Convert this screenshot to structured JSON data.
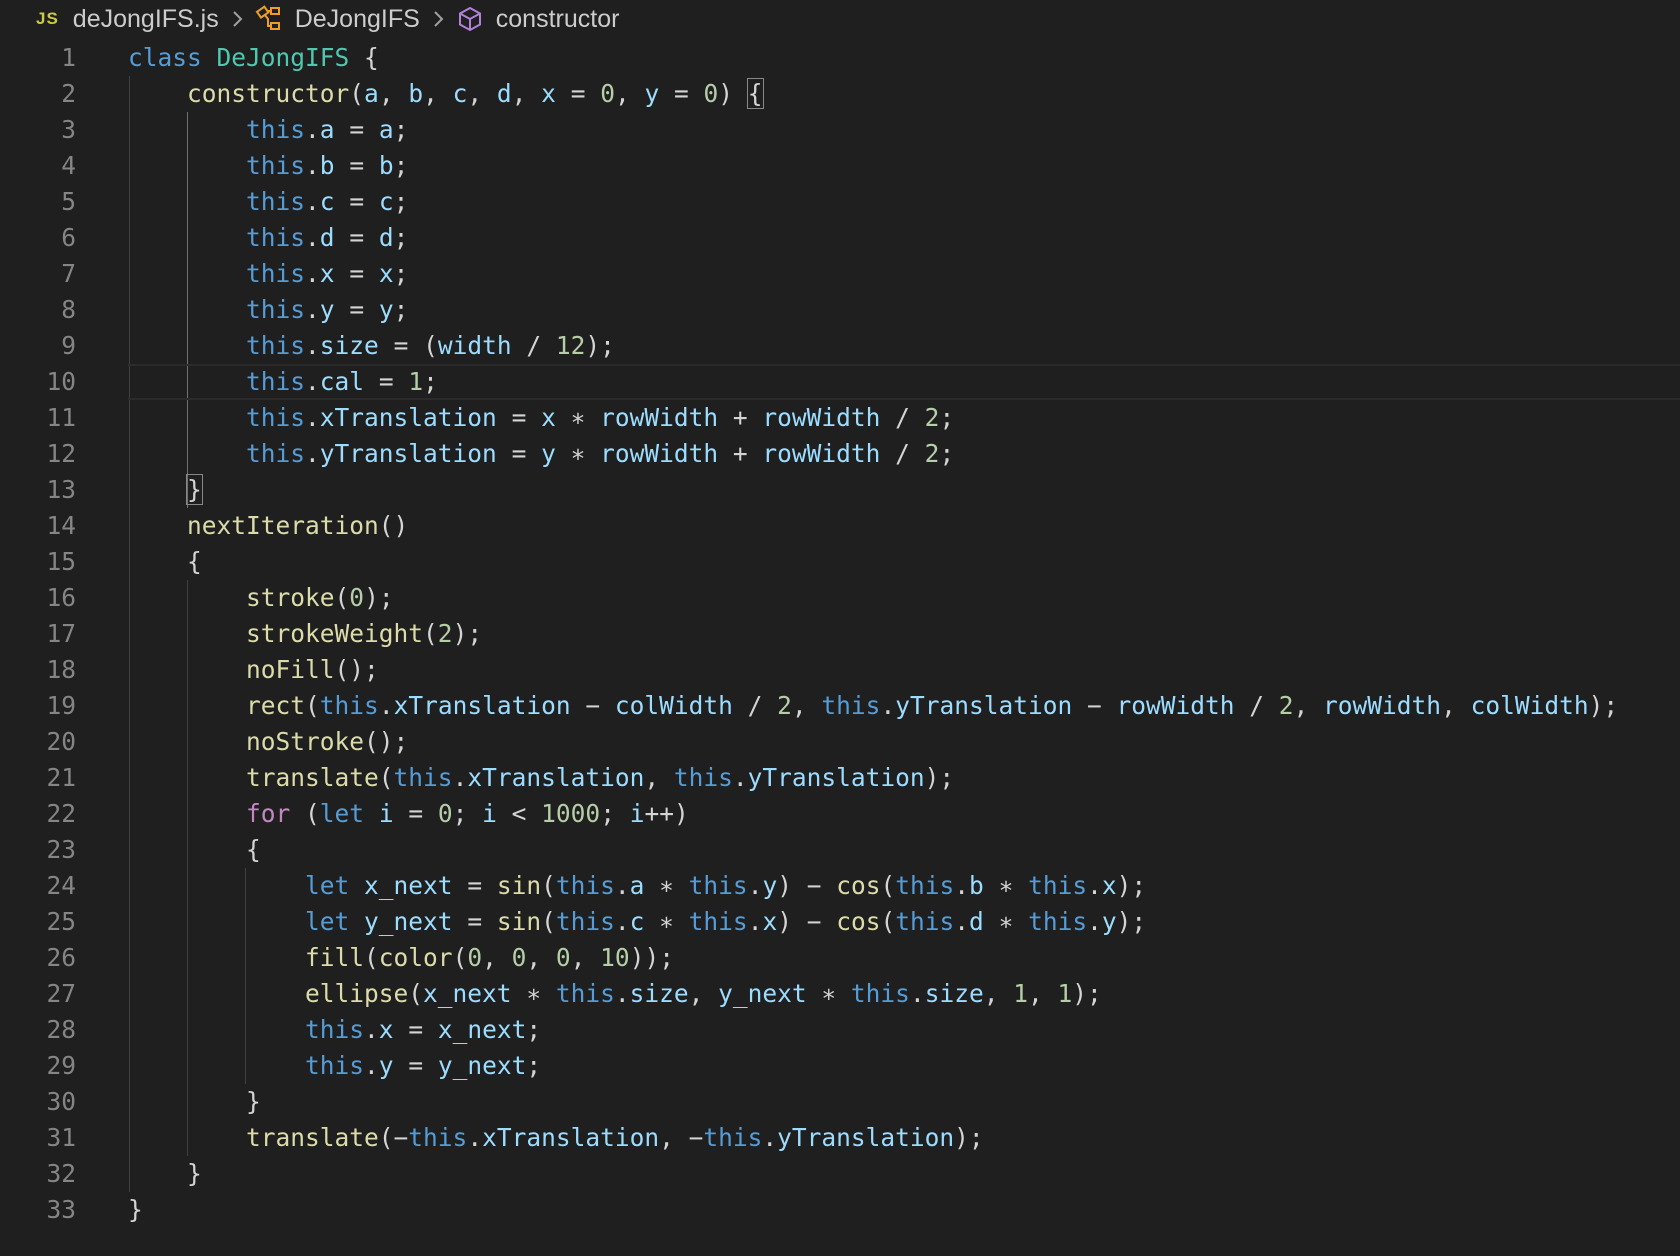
{
  "breadcrumb": {
    "file_badge": "JS",
    "file_name": "deJongIFS.js",
    "class_name": "DeJongIFS",
    "method_name": "constructor"
  },
  "colors": {
    "background": "#1f1f1f",
    "keyword": "#569cd6",
    "control": "#c586c0",
    "class": "#4ec9b0",
    "function": "#dcdcaa",
    "variable": "#9cdcfe",
    "number": "#b5cea8",
    "punctuation": "#d4d4d4",
    "line_number": "#858585"
  },
  "editor": {
    "current_line": 10,
    "lines": [
      [
        [
          "kw",
          "class"
        ],
        [
          "pun",
          " "
        ],
        [
          "cls",
          "DeJongIFS"
        ],
        [
          "pun",
          " {"
        ]
      ],
      [
        [
          "pun",
          "    "
        ],
        [
          "fn",
          "constructor"
        ],
        [
          "pun",
          "("
        ],
        [
          "var",
          "a"
        ],
        [
          "pun",
          ", "
        ],
        [
          "var",
          "b"
        ],
        [
          "pun",
          ", "
        ],
        [
          "var",
          "c"
        ],
        [
          "pun",
          ", "
        ],
        [
          "var",
          "d"
        ],
        [
          "pun",
          ", "
        ],
        [
          "var",
          "x"
        ],
        [
          "pun",
          " = "
        ],
        [
          "num",
          "0"
        ],
        [
          "pun",
          ", "
        ],
        [
          "var",
          "y"
        ],
        [
          "pun",
          " = "
        ],
        [
          "num",
          "0"
        ],
        [
          "pun",
          ") "
        ],
        [
          "box",
          "{"
        ]
      ],
      [
        [
          "pun",
          "        "
        ],
        [
          "kw",
          "this"
        ],
        [
          "pun",
          "."
        ],
        [
          "var",
          "a"
        ],
        [
          "pun",
          " = "
        ],
        [
          "var",
          "a"
        ],
        [
          "pun",
          ";"
        ]
      ],
      [
        [
          "pun",
          "        "
        ],
        [
          "kw",
          "this"
        ],
        [
          "pun",
          "."
        ],
        [
          "var",
          "b"
        ],
        [
          "pun",
          " = "
        ],
        [
          "var",
          "b"
        ],
        [
          "pun",
          ";"
        ]
      ],
      [
        [
          "pun",
          "        "
        ],
        [
          "kw",
          "this"
        ],
        [
          "pun",
          "."
        ],
        [
          "var",
          "c"
        ],
        [
          "pun",
          " = "
        ],
        [
          "var",
          "c"
        ],
        [
          "pun",
          ";"
        ]
      ],
      [
        [
          "pun",
          "        "
        ],
        [
          "kw",
          "this"
        ],
        [
          "pun",
          "."
        ],
        [
          "var",
          "d"
        ],
        [
          "pun",
          " = "
        ],
        [
          "var",
          "d"
        ],
        [
          "pun",
          ";"
        ]
      ],
      [
        [
          "pun",
          "        "
        ],
        [
          "kw",
          "this"
        ],
        [
          "pun",
          "."
        ],
        [
          "var",
          "x"
        ],
        [
          "pun",
          " = "
        ],
        [
          "var",
          "x"
        ],
        [
          "pun",
          ";"
        ]
      ],
      [
        [
          "pun",
          "        "
        ],
        [
          "kw",
          "this"
        ],
        [
          "pun",
          "."
        ],
        [
          "var",
          "y"
        ],
        [
          "pun",
          " = "
        ],
        [
          "var",
          "y"
        ],
        [
          "pun",
          ";"
        ]
      ],
      [
        [
          "pun",
          "        "
        ],
        [
          "kw",
          "this"
        ],
        [
          "pun",
          "."
        ],
        [
          "var",
          "size"
        ],
        [
          "pun",
          " = ("
        ],
        [
          "var",
          "width"
        ],
        [
          "pun",
          " / "
        ],
        [
          "num",
          "12"
        ],
        [
          "pun",
          ");"
        ]
      ],
      [
        [
          "pun",
          "        "
        ],
        [
          "kw",
          "this"
        ],
        [
          "pun",
          "."
        ],
        [
          "var",
          "cal"
        ],
        [
          "pun",
          " = "
        ],
        [
          "num",
          "1"
        ],
        [
          "pun",
          ";"
        ]
      ],
      [
        [
          "pun",
          "        "
        ],
        [
          "kw",
          "this"
        ],
        [
          "pun",
          "."
        ],
        [
          "var",
          "xTranslation"
        ],
        [
          "pun",
          " = "
        ],
        [
          "var",
          "x"
        ],
        [
          "pun",
          " ∗ "
        ],
        [
          "var",
          "rowWidth"
        ],
        [
          "pun",
          " + "
        ],
        [
          "var",
          "rowWidth"
        ],
        [
          "pun",
          " / "
        ],
        [
          "num",
          "2"
        ],
        [
          "pun",
          ";"
        ]
      ],
      [
        [
          "pun",
          "        "
        ],
        [
          "kw",
          "this"
        ],
        [
          "pun",
          "."
        ],
        [
          "var",
          "yTranslation"
        ],
        [
          "pun",
          " = "
        ],
        [
          "var",
          "y"
        ],
        [
          "pun",
          " ∗ "
        ],
        [
          "var",
          "rowWidth"
        ],
        [
          "pun",
          " + "
        ],
        [
          "var",
          "rowWidth"
        ],
        [
          "pun",
          " / "
        ],
        [
          "num",
          "2"
        ],
        [
          "pun",
          ";"
        ]
      ],
      [
        [
          "pun",
          "    "
        ],
        [
          "box",
          "}"
        ]
      ],
      [
        [
          "pun",
          "    "
        ],
        [
          "fn",
          "nextIteration"
        ],
        [
          "pun",
          "()"
        ]
      ],
      [
        [
          "pun",
          "    {"
        ]
      ],
      [
        [
          "pun",
          "        "
        ],
        [
          "fn",
          "stroke"
        ],
        [
          "pun",
          "("
        ],
        [
          "num",
          "0"
        ],
        [
          "pun",
          ");"
        ]
      ],
      [
        [
          "pun",
          "        "
        ],
        [
          "fn",
          "strokeWeight"
        ],
        [
          "pun",
          "("
        ],
        [
          "num",
          "2"
        ],
        [
          "pun",
          ");"
        ]
      ],
      [
        [
          "pun",
          "        "
        ],
        [
          "fn",
          "noFill"
        ],
        [
          "pun",
          "();"
        ]
      ],
      [
        [
          "pun",
          "        "
        ],
        [
          "fn",
          "rect"
        ],
        [
          "pun",
          "("
        ],
        [
          "kw",
          "this"
        ],
        [
          "pun",
          "."
        ],
        [
          "var",
          "xTranslation"
        ],
        [
          "pun",
          " − "
        ],
        [
          "var",
          "colWidth"
        ],
        [
          "pun",
          " / "
        ],
        [
          "num",
          "2"
        ],
        [
          "pun",
          ", "
        ],
        [
          "kw",
          "this"
        ],
        [
          "pun",
          "."
        ],
        [
          "var",
          "yTranslation"
        ],
        [
          "pun",
          " − "
        ],
        [
          "var",
          "rowWidth"
        ],
        [
          "pun",
          " / "
        ],
        [
          "num",
          "2"
        ],
        [
          "pun",
          ", "
        ],
        [
          "var",
          "rowWidth"
        ],
        [
          "pun",
          ", "
        ],
        [
          "var",
          "colWidth"
        ],
        [
          "pun",
          ");"
        ]
      ],
      [
        [
          "pun",
          "        "
        ],
        [
          "fn",
          "noStroke"
        ],
        [
          "pun",
          "();"
        ]
      ],
      [
        [
          "pun",
          "        "
        ],
        [
          "fn",
          "translate"
        ],
        [
          "pun",
          "("
        ],
        [
          "kw",
          "this"
        ],
        [
          "pun",
          "."
        ],
        [
          "var",
          "xTranslation"
        ],
        [
          "pun",
          ", "
        ],
        [
          "kw",
          "this"
        ],
        [
          "pun",
          "."
        ],
        [
          "var",
          "yTranslation"
        ],
        [
          "pun",
          ");"
        ]
      ],
      [
        [
          "pun",
          "        "
        ],
        [
          "ctl",
          "for"
        ],
        [
          "pun",
          " ("
        ],
        [
          "kw",
          "let"
        ],
        [
          "pun",
          " "
        ],
        [
          "var",
          "i"
        ],
        [
          "pun",
          " = "
        ],
        [
          "num",
          "0"
        ],
        [
          "pun",
          "; "
        ],
        [
          "var",
          "i"
        ],
        [
          "pun",
          " < "
        ],
        [
          "num",
          "1000"
        ],
        [
          "pun",
          "; "
        ],
        [
          "var",
          "i"
        ],
        [
          "pun",
          "++)"
        ]
      ],
      [
        [
          "pun",
          "        {"
        ]
      ],
      [
        [
          "pun",
          "            "
        ],
        [
          "kw",
          "let"
        ],
        [
          "pun",
          " "
        ],
        [
          "var",
          "x_next"
        ],
        [
          "pun",
          " = "
        ],
        [
          "fn",
          "sin"
        ],
        [
          "pun",
          "("
        ],
        [
          "kw",
          "this"
        ],
        [
          "pun",
          "."
        ],
        [
          "var",
          "a"
        ],
        [
          "pun",
          " ∗ "
        ],
        [
          "kw",
          "this"
        ],
        [
          "pun",
          "."
        ],
        [
          "var",
          "y"
        ],
        [
          "pun",
          ") − "
        ],
        [
          "fn",
          "cos"
        ],
        [
          "pun",
          "("
        ],
        [
          "kw",
          "this"
        ],
        [
          "pun",
          "."
        ],
        [
          "var",
          "b"
        ],
        [
          "pun",
          " ∗ "
        ],
        [
          "kw",
          "this"
        ],
        [
          "pun",
          "."
        ],
        [
          "var",
          "x"
        ],
        [
          "pun",
          ");"
        ]
      ],
      [
        [
          "pun",
          "            "
        ],
        [
          "kw",
          "let"
        ],
        [
          "pun",
          " "
        ],
        [
          "var",
          "y_next"
        ],
        [
          "pun",
          " = "
        ],
        [
          "fn",
          "sin"
        ],
        [
          "pun",
          "("
        ],
        [
          "kw",
          "this"
        ],
        [
          "pun",
          "."
        ],
        [
          "var",
          "c"
        ],
        [
          "pun",
          " ∗ "
        ],
        [
          "kw",
          "this"
        ],
        [
          "pun",
          "."
        ],
        [
          "var",
          "x"
        ],
        [
          "pun",
          ") − "
        ],
        [
          "fn",
          "cos"
        ],
        [
          "pun",
          "("
        ],
        [
          "kw",
          "this"
        ],
        [
          "pun",
          "."
        ],
        [
          "var",
          "d"
        ],
        [
          "pun",
          " ∗ "
        ],
        [
          "kw",
          "this"
        ],
        [
          "pun",
          "."
        ],
        [
          "var",
          "y"
        ],
        [
          "pun",
          ");"
        ]
      ],
      [
        [
          "pun",
          "            "
        ],
        [
          "fn",
          "fill"
        ],
        [
          "pun",
          "("
        ],
        [
          "fn",
          "color"
        ],
        [
          "pun",
          "("
        ],
        [
          "num",
          "0"
        ],
        [
          "pun",
          ", "
        ],
        [
          "num",
          "0"
        ],
        [
          "pun",
          ", "
        ],
        [
          "num",
          "0"
        ],
        [
          "pun",
          ", "
        ],
        [
          "num",
          "10"
        ],
        [
          "pun",
          "));"
        ]
      ],
      [
        [
          "pun",
          "            "
        ],
        [
          "fn",
          "ellipse"
        ],
        [
          "pun",
          "("
        ],
        [
          "var",
          "x_next"
        ],
        [
          "pun",
          " ∗ "
        ],
        [
          "kw",
          "this"
        ],
        [
          "pun",
          "."
        ],
        [
          "var",
          "size"
        ],
        [
          "pun",
          ", "
        ],
        [
          "var",
          "y_next"
        ],
        [
          "pun",
          " ∗ "
        ],
        [
          "kw",
          "this"
        ],
        [
          "pun",
          "."
        ],
        [
          "var",
          "size"
        ],
        [
          "pun",
          ", "
        ],
        [
          "num",
          "1"
        ],
        [
          "pun",
          ", "
        ],
        [
          "num",
          "1"
        ],
        [
          "pun",
          ");"
        ]
      ],
      [
        [
          "pun",
          "            "
        ],
        [
          "kw",
          "this"
        ],
        [
          "pun",
          "."
        ],
        [
          "var",
          "x"
        ],
        [
          "pun",
          " = "
        ],
        [
          "var",
          "x_next"
        ],
        [
          "pun",
          ";"
        ]
      ],
      [
        [
          "pun",
          "            "
        ],
        [
          "kw",
          "this"
        ],
        [
          "pun",
          "."
        ],
        [
          "var",
          "y"
        ],
        [
          "pun",
          " = "
        ],
        [
          "var",
          "y_next"
        ],
        [
          "pun",
          ";"
        ]
      ],
      [
        [
          "pun",
          "        }"
        ]
      ],
      [
        [
          "pun",
          "        "
        ],
        [
          "fn",
          "translate"
        ],
        [
          "pun",
          "(−"
        ],
        [
          "kw",
          "this"
        ],
        [
          "pun",
          "."
        ],
        [
          "var",
          "xTranslation"
        ],
        [
          "pun",
          ", −"
        ],
        [
          "kw",
          "this"
        ],
        [
          "pun",
          "."
        ],
        [
          "var",
          "yTranslation"
        ],
        [
          "pun",
          ");"
        ]
      ],
      [
        [
          "pun",
          "    }"
        ]
      ],
      [
        [
          "pun",
          "}"
        ]
      ]
    ]
  }
}
